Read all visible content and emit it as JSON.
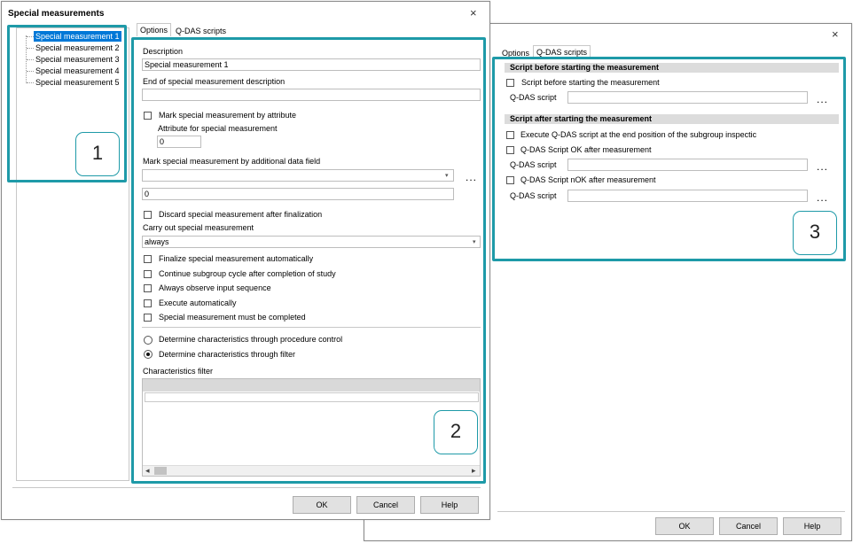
{
  "dialog1": {
    "title": "Special measurements",
    "close_glyph": "×",
    "tree": {
      "items": [
        {
          "label": "Special measurement 1",
          "selected": true
        },
        {
          "label": "Special measurement 2",
          "selected": false
        },
        {
          "label": "Special measurement 3",
          "selected": false
        },
        {
          "label": "Special measurement 4",
          "selected": false
        },
        {
          "label": "Special measurement 5",
          "selected": false
        }
      ]
    },
    "tabs": [
      {
        "label": "Options",
        "active": true
      },
      {
        "label": "Q-DAS scripts",
        "active": false
      }
    ],
    "options": {
      "description_label": "Description",
      "description_value": "Special measurement 1",
      "end_description_label": "End of special measurement description",
      "end_description_value": "",
      "mark_by_attribute_label": "Mark special measurement by attribute",
      "attribute_label": "Attribute for special measurement",
      "attribute_value": "0",
      "mark_additional_label": "Mark special measurement by additional data field",
      "additional_select_value": "",
      "additional_value": "0",
      "dots": "...",
      "discard_label": "Discard special measurement after finalization",
      "carry_out_label": "Carry out special measurement",
      "carry_out_value": "always",
      "checkboxes": [
        "Finalize special measurement automatically",
        "Continue subgroup cycle after completion of study",
        "Always observe input sequence",
        "Execute automatically",
        "Special measurement must be completed"
      ],
      "radio_procedure": "Determine characteristics through procedure control",
      "radio_filter": "Determine characteristics through filter",
      "filter_label": "Characteristics filter"
    },
    "buttons": {
      "ok": "OK",
      "cancel": "Cancel",
      "help": "Help"
    }
  },
  "dialog2": {
    "close_glyph": "×",
    "tabs": [
      {
        "label": "Options",
        "active": false
      },
      {
        "label": "Q-DAS scripts",
        "active": true
      }
    ],
    "section_before": "Script before starting the measurement",
    "before_checkbox": "Script before starting the measurement",
    "section_after": "Script after starting the measurement",
    "after_checkbox_1": "Execute Q-DAS script at the end position of the subgroup inspectic",
    "ok_checkbox": "Q-DAS Script OK after measurement",
    "nok_checkbox": "Q-DAS Script nOK after measurement",
    "script_label": "Q-DAS script",
    "dots": "...",
    "buttons": {
      "ok": "OK",
      "cancel": "Cancel",
      "help": "Help"
    }
  },
  "badges": {
    "one": "1",
    "two": "2",
    "three": "3"
  },
  "colors": {
    "highlight": "#1e9aa8",
    "selection": "#0078d7"
  },
  "scroll_left": "◂",
  "scroll_right": "▸",
  "dropdown_caret": "▾"
}
